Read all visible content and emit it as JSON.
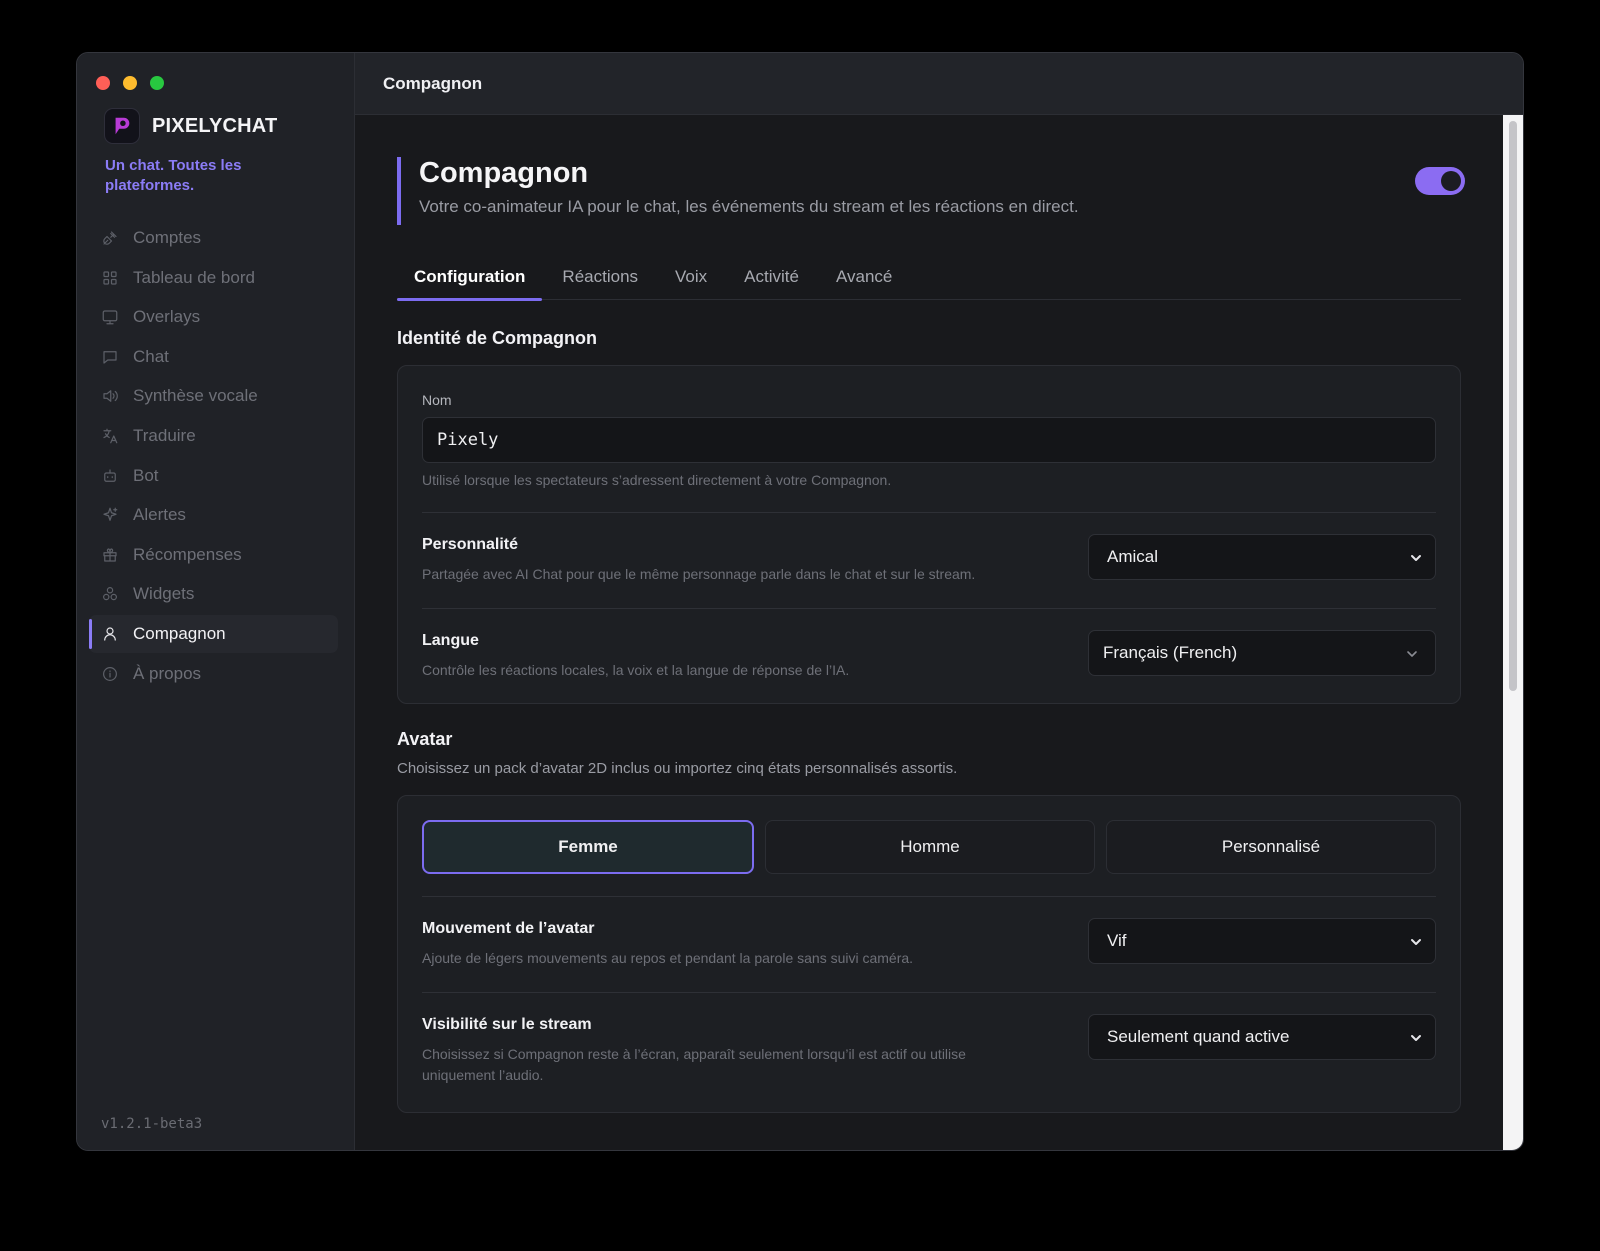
{
  "app": {
    "name": "PIXELYCHAT",
    "tagline": "Un chat. Toutes les plateformes.",
    "version": "v1.2.1-beta3",
    "accent_color": "#8b7cf6"
  },
  "sidebar": {
    "items": [
      {
        "label": "Comptes",
        "icon": "plug-icon"
      },
      {
        "label": "Tableau de bord",
        "icon": "grid-icon"
      },
      {
        "label": "Overlays",
        "icon": "monitor-icon"
      },
      {
        "label": "Chat",
        "icon": "chat-bubble-icon"
      },
      {
        "label": "Synthèse vocale",
        "icon": "speaker-icon"
      },
      {
        "label": "Traduire",
        "icon": "translate-icon"
      },
      {
        "label": "Bot",
        "icon": "robot-icon"
      },
      {
        "label": "Alertes",
        "icon": "sparkle-icon"
      },
      {
        "label": "Récompenses",
        "icon": "gift-icon"
      },
      {
        "label": "Widgets",
        "icon": "shapes-icon"
      },
      {
        "label": "Compagnon",
        "icon": "user-icon",
        "active": true
      },
      {
        "label": "À propos",
        "icon": "info-icon"
      }
    ]
  },
  "header": {
    "title": "Compagnon"
  },
  "page": {
    "title": "Compagnon",
    "subtitle": "Votre co-animateur IA pour le chat, les événements du stream et les réactions en direct.",
    "enabled": true
  },
  "tabs": [
    {
      "label": "Configuration",
      "active": true
    },
    {
      "label": "Réactions"
    },
    {
      "label": "Voix"
    },
    {
      "label": "Activité"
    },
    {
      "label": "Avancé"
    }
  ],
  "identity": {
    "section_title": "Identité de Compagnon",
    "name_label": "Nom",
    "name_value": "Pixely",
    "name_hint": "Utilisé lorsque les spectateurs s’adressent directement à votre Compagnon.",
    "personality": {
      "title": "Personnalité",
      "hint": "Partagée avec AI Chat pour que le même personnage parle dans le chat et sur le stream.",
      "value": "Amical"
    },
    "language": {
      "title": "Langue",
      "hint": "Contrôle les réactions locales, la voix et la langue de réponse de l’IA.",
      "value": "Français (French)"
    }
  },
  "avatar": {
    "section_title": "Avatar",
    "section_desc": "Choisissez un pack d’avatar 2D inclus ou importez cinq états personnalisés assortis.",
    "options": [
      {
        "label": "Femme",
        "active": true
      },
      {
        "label": "Homme"
      },
      {
        "label": "Personnalisé"
      }
    ],
    "movement": {
      "title": "Mouvement de l’avatar",
      "hint": "Ajoute de légers mouvements au repos et pendant la parole sans suivi caméra.",
      "value": "Vif"
    },
    "visibility": {
      "title": "Visibilité sur le stream",
      "hint": "Choisissez si Compagnon reste à l’écran, apparaît seulement lorsqu’il est actif ou utilise uniquement l’audio.",
      "value": "Seulement quand active"
    }
  }
}
